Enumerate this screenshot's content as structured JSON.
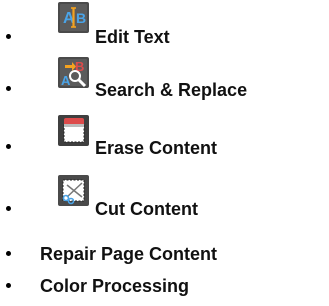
{
  "items": [
    {
      "label": "Edit Text",
      "icon": "edit-text-icon"
    },
    {
      "label": "Search & Replace",
      "icon": "search-replace-icon"
    },
    {
      "label": "Erase Content",
      "icon": "erase-content-icon"
    },
    {
      "label": "Cut Content",
      "icon": "cut-content-icon"
    },
    {
      "label": "Repair Page Content"
    },
    {
      "label": "Color Processing"
    }
  ],
  "colors": {
    "text": "#111111",
    "icon_background": "#4a4a4a",
    "icon_accent_blue": "#4aa4e8",
    "icon_accent_orange": "#f4a21f",
    "icon_accent_red": "#dd4b4b"
  }
}
